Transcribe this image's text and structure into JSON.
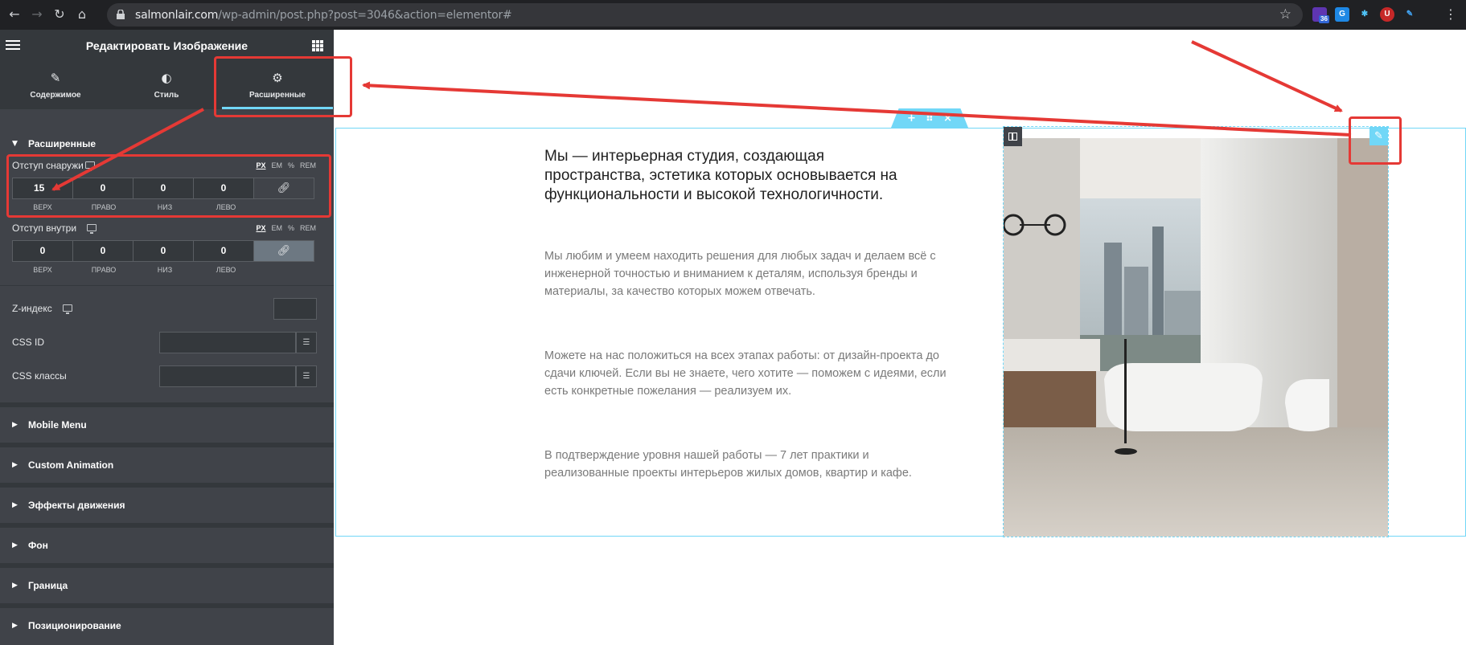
{
  "browser": {
    "url_host": "salmonlair.com",
    "url_path": "/wp-admin/post.php?post=3046&action=elementor#",
    "extension_badge": "36",
    "extension_labels": [
      "G",
      "U"
    ]
  },
  "sidebar": {
    "title": "Редактировать Изображение",
    "tabs": [
      {
        "label": "Содержимое",
        "icon": "pencil-icon"
      },
      {
        "label": "Стиль",
        "icon": "contrast-icon"
      },
      {
        "label": "Расширенные",
        "icon": "gear-icon",
        "active": true
      }
    ],
    "advanced": {
      "title": "Расширенные",
      "margin": {
        "label": "Отступ снаружи",
        "units": [
          "PX",
          "EM",
          "%",
          "REM"
        ],
        "active_unit": "PX",
        "values": {
          "top": "15",
          "right": "0",
          "bottom": "0",
          "left": "0"
        },
        "labels": {
          "top": "ВЕРХ",
          "right": "ПРАВО",
          "bottom": "НИЗ",
          "left": "ЛЕВО"
        },
        "linked": false
      },
      "padding": {
        "label": "Отступ внутри",
        "units": [
          "PX",
          "EM",
          "%",
          "REM"
        ],
        "active_unit": "PX",
        "values": {
          "top": "0",
          "right": "0",
          "bottom": "0",
          "left": "0"
        },
        "labels": {
          "top": "ВЕРХ",
          "right": "ПРАВО",
          "bottom": "НИЗ",
          "left": "ЛЕВО"
        },
        "linked": true
      },
      "zindex_label": "Z-индекс",
      "zindex_value": "",
      "css_id_label": "CSS ID",
      "css_id_value": "",
      "css_classes_label": "CSS классы",
      "css_classes_value": ""
    },
    "collapsed_sections": [
      "Mobile Menu",
      "Custom Animation",
      "Эффекты движения",
      "Фон",
      "Граница",
      "Позиционирование"
    ]
  },
  "canvas": {
    "headline": "Мы — интерьерная студия, создающая пространства, эстетика которых основывается на функциональности и высокой технологичности.",
    "paragraphs": [
      "Мы любим и умеем находить решения для любых задач и делаем всё с инженерной точностью и вниманием к деталям, используя бренды и материалы, за качество которых можем отвечать.",
      "Можете на нас положиться на всех этапах работы: от дизайн-проекта до сдачи ключей. Если вы не знаете, чего хотите — поможем с идеями, если есть конкретные пожелания — реализуем их.",
      "В подтверждение уровня нашей работы — 7 лет практики и реализованные проекты интерьеров жилых домов, квартир и кафе."
    ],
    "section_handle_icons": [
      "plus-icon",
      "drag-icon",
      "close-icon"
    ],
    "image_icon": "bathroom-photo"
  },
  "colors": {
    "accent": "#71d7f7",
    "sidebar_bg": "#404349",
    "sidebar_header": "#34383c",
    "annotation": "#e53935"
  }
}
